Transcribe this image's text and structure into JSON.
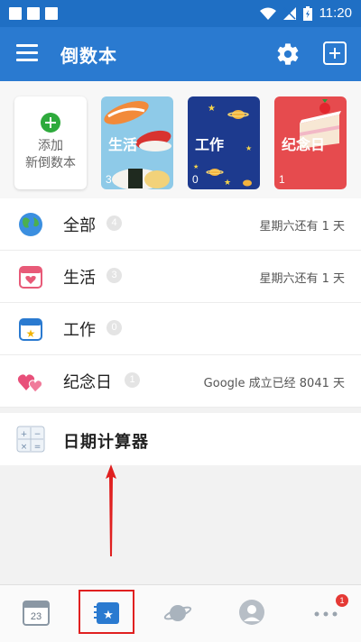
{
  "status_bar": {
    "time": "11:20"
  },
  "app_bar": {
    "title": "倒数本"
  },
  "cards": {
    "add": {
      "line1": "添加",
      "line2": "新倒数本"
    },
    "books": [
      {
        "title": "生活",
        "count": "3"
      },
      {
        "title": "工作",
        "count": "0"
      },
      {
        "title": "纪念日",
        "count": "1"
      }
    ]
  },
  "list": [
    {
      "label": "全部",
      "count": "4",
      "status": "星期六还有 1 天"
    },
    {
      "label": "生活",
      "count": "3",
      "status": "星期六还有 1 天"
    },
    {
      "label": "工作",
      "count": "0",
      "status": ""
    },
    {
      "label": "纪念日",
      "count": "1",
      "status": "Google 成立已经 8041 天"
    }
  ],
  "tools": {
    "date_calculator": "日期计算器"
  },
  "bottom_nav": {
    "calendar_day": "23",
    "more_badge": "1"
  },
  "colors": {
    "primary": "#2a7ad0",
    "status_bar": "#1f6fc4",
    "highlight": "#e02020"
  }
}
